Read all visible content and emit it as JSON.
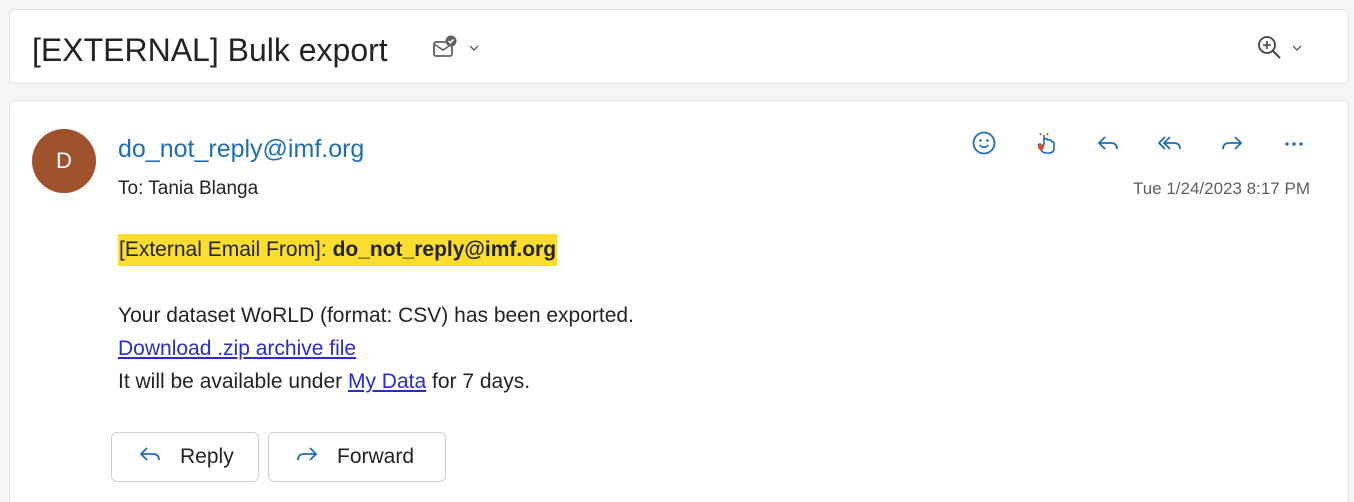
{
  "subject": {
    "title": "[EXTERNAL] Bulk export"
  },
  "message": {
    "avatar_initial": "D",
    "sender": "do_not_reply@imf.org",
    "to_label": "To:",
    "to_name": "Tania Blanga",
    "timestamp": "Tue 1/24/2023 8:17 PM",
    "banner_prefix": "[External Email From]:",
    "banner_sender": "do_not_reply@imf.org",
    "line1": "Your dataset WoRLD (format: CSV) has been exported.",
    "download_link": "Download .zip archive file",
    "line3_before": "It will be available under",
    "my_data_link": "My Data",
    "line3_after": "for 7 days."
  },
  "buttons": {
    "reply": "Reply",
    "forward": "Forward"
  },
  "icons": {
    "subject_icon": "mail-flag-icon",
    "zoom_icon": "zoom-icon",
    "actions": [
      "smiley-icon",
      "touch-icon",
      "reply-icon",
      "reply-all-icon",
      "forward-icon",
      "more-icon"
    ]
  },
  "colors": {
    "sender_link": "#1f6fb5",
    "avatar_bg": "#a0522d",
    "banner_bg": "#fbdd2f",
    "body_link": "#2b2bd6"
  }
}
